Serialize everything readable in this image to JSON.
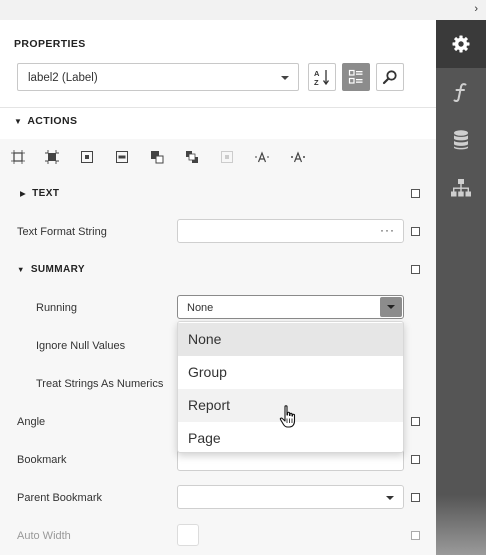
{
  "panel": {
    "collapse_glyph": "›",
    "title": "PROPERTIES",
    "component_select": {
      "value": "label2 (Label)"
    },
    "toolbar": {
      "sort_icon": "sort-az-icon",
      "categories_icon": "categories-icon",
      "search_icon": "search-icon"
    }
  },
  "actions": {
    "label": "ACTIONS",
    "icons": [
      "fit-bounds-icon",
      "fit-to-container-icon",
      "center-horizontally-icon",
      "center-vertically-icon",
      "bring-to-front-icon",
      "send-to-back-icon",
      "disabled-action-icon",
      "decrease-font-icon",
      "increase-font-icon"
    ]
  },
  "properties": {
    "text_section": "TEXT",
    "text_format_string": {
      "label": "Text Format String",
      "value": "",
      "button": "···"
    },
    "summary_section": "SUMMARY",
    "running": {
      "label": "Running",
      "value": "None"
    },
    "ignore_null_values": {
      "label": "Ignore Null Values"
    },
    "treat_strings_as_numerics": {
      "label": "Treat Strings As Numerics"
    },
    "angle": {
      "label": "Angle"
    },
    "bookmark": {
      "label": "Bookmark"
    },
    "parent_bookmark": {
      "label": "Parent Bookmark",
      "value": ""
    },
    "auto_width": {
      "label": "Auto Width"
    }
  },
  "running_dropdown": {
    "options": [
      "None",
      "Group",
      "Report",
      "Page"
    ],
    "selected": "None",
    "hovered": "Report"
  },
  "side_tabs": [
    "gear-icon",
    "function-icon",
    "database-icon",
    "hierarchy-icon"
  ],
  "colors": {
    "sidebar": "#555555",
    "sidebar_active": "#3a3a3a",
    "button_active": "#8c8c8c"
  }
}
